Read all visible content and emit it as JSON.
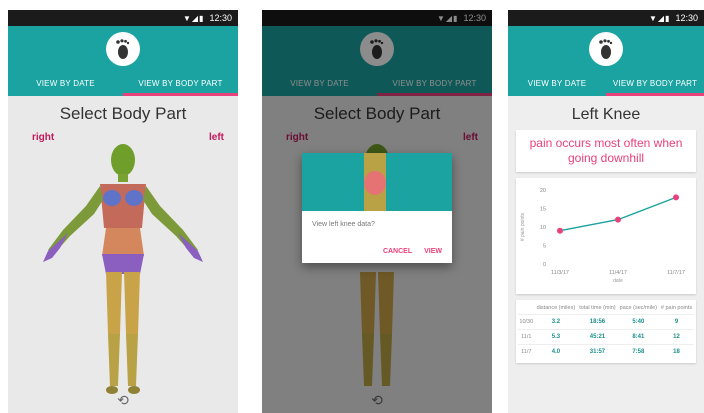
{
  "status": {
    "time": "12:30"
  },
  "tabs": {
    "by_date": "VIEW BY DATE",
    "by_body_part": "VIEW BY BODY PART"
  },
  "screen1": {
    "title": "Select Body Part",
    "right_label": "right",
    "left_label": "left"
  },
  "screen2": {
    "title": "Select Body Part",
    "right_label": "right",
    "left_label": "left",
    "dialog": {
      "message": "View left knee data?",
      "cancel": "CANCEL",
      "view": "VIEW"
    }
  },
  "screen3": {
    "title": "Left Knee",
    "pain_note": "pain occurs most often when going downhill",
    "chart_data": {
      "type": "line",
      "x": [
        "11/3/17",
        "11/4/17",
        "11/7/17"
      ],
      "xlabel": "date",
      "ylabel": "# pain points",
      "ylim": [
        0,
        20
      ],
      "yticks": [
        0,
        5,
        10,
        15,
        20
      ],
      "series": [
        {
          "values": [
            9,
            12,
            18
          ]
        }
      ]
    },
    "table": {
      "headers": [
        "",
        "distance (miles)",
        "total time (min)",
        "pace (sec/mile)",
        "# pain points"
      ],
      "rows": [
        [
          "10/30",
          "3.2",
          "18:56",
          "5:40",
          "9"
        ],
        [
          "11/1",
          "5.3",
          "45:21",
          "8:41",
          "12"
        ],
        [
          "11/7",
          "4.0",
          "31:57",
          "7:58",
          "18"
        ]
      ]
    }
  },
  "colors": {
    "teal": "#1aa3a0",
    "accent": "#e8417b"
  }
}
